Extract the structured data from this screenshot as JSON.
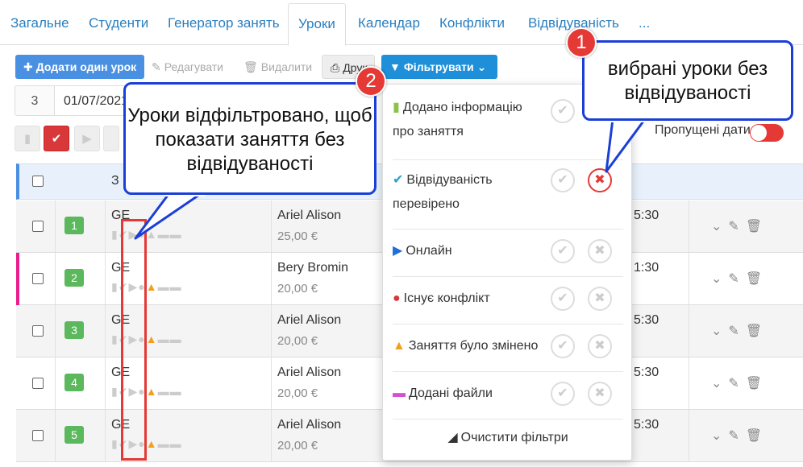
{
  "tabs": [
    {
      "label": "Загальне"
    },
    {
      "label": "Студенти"
    },
    {
      "label": "Генератор занять"
    },
    {
      "label": "Уроки"
    },
    {
      "label": "Календар"
    },
    {
      "label": "Конфлікти"
    },
    {
      "label": "Відвідуваність"
    },
    {
      "label": "..."
    }
  ],
  "toolbar": {
    "add_one": "Додати один урок",
    "edit": "Редагувати",
    "delete": "Видалити",
    "print": "Друк",
    "filter": "Фільтрувати"
  },
  "date_row": {
    "count": "3",
    "date": "01/07/2021"
  },
  "missed_dates_label": "Пропущені дати",
  "table": {
    "header_col": "З",
    "rows": [
      {
        "num": "1",
        "code": "GE",
        "teacher": "Ariel Alison",
        "price": "25,00 €",
        "time": "5:30",
        "marker": ""
      },
      {
        "num": "2",
        "code": "GE",
        "teacher": "Bery Bromin",
        "price": "20,00 €",
        "time": "1:30",
        "marker": "#e91e8c"
      },
      {
        "num": "3",
        "code": "GE",
        "teacher": "Ariel Alison",
        "price": "20,00 €",
        "time": "5:30",
        "marker": ""
      },
      {
        "num": "4",
        "code": "GE",
        "teacher": "Ariel Alison",
        "price": "20,00 €",
        "time": "5:30",
        "marker": ""
      },
      {
        "num": "5",
        "code": "GE",
        "teacher": "Ariel Alison",
        "price": "20,00 €",
        "time": "5:30",
        "marker": ""
      }
    ]
  },
  "filter_menu": {
    "items": [
      {
        "label": "Додано інформацію про заняття",
        "icon": "document-icon",
        "color": "#8bc34a"
      },
      {
        "label": "Відвідуваність перевірено",
        "icon": "check-icon",
        "color": "#2a9fd6"
      },
      {
        "label": "Онлайн",
        "icon": "video-icon",
        "color": "#1e6fd8"
      },
      {
        "label": "Існує конфлікт",
        "icon": "exclamation-icon",
        "color": "#d9383a"
      },
      {
        "label": "Заняття було змінено",
        "icon": "warning-icon",
        "color": "#f0a020"
      },
      {
        "label": "Додані файли",
        "icon": "folder-icon",
        "color": "#d44fd4"
      }
    ],
    "clear_label": "Очистити фільтри"
  },
  "callouts": {
    "one": {
      "number": "1",
      "text": "вибрані уроки без відвідуваності"
    },
    "two": {
      "number": "2",
      "text": "Уроки відфільтровано, щоб показати заняття без відвідуваності"
    }
  }
}
